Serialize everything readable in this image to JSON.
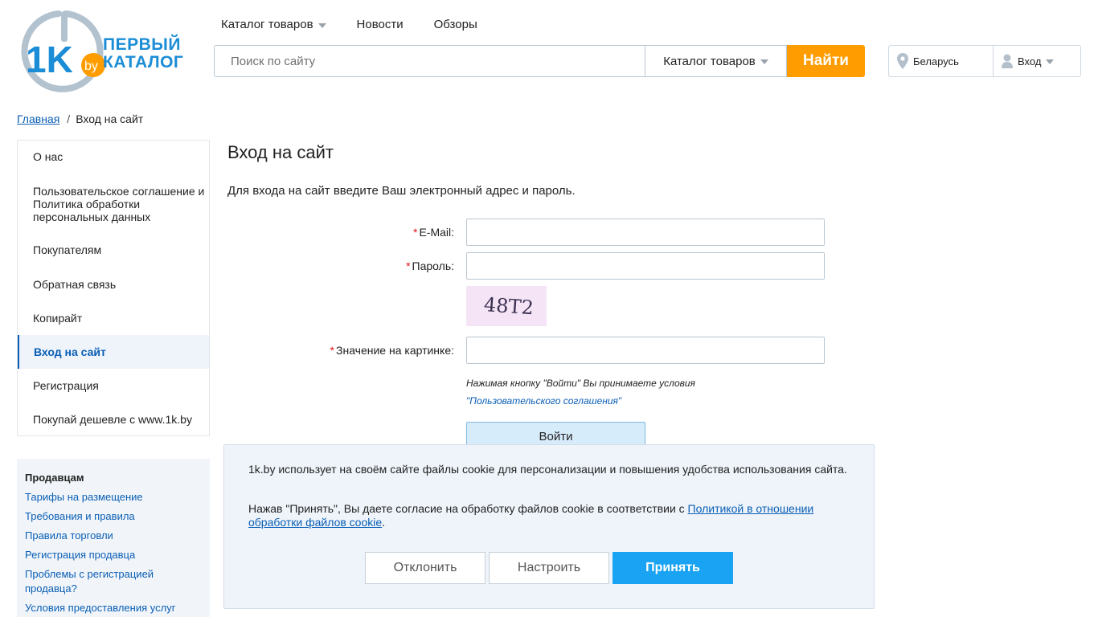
{
  "header": {
    "logo": {
      "main": "1K",
      "badge": "by",
      "line1": "ПЕРВЫЙ",
      "line2": "КАТАЛОГ"
    },
    "nav": [
      "Каталог товаров",
      "Новости",
      "Обзоры"
    ],
    "search": {
      "placeholder": "Поиск по сайту",
      "category": "Каталог товаров",
      "button": "Найти"
    },
    "region": "Беларусь",
    "login": "Вход",
    "colors": {
      "brand": "#1b8dd6",
      "search_button": "#ff9d00"
    }
  },
  "breadcrumb": {
    "home": "Главная",
    "separator": "/",
    "current": "Вход на сайт"
  },
  "sidebar": {
    "items": [
      "О нас",
      "Пользовательское соглашение и Политика обработки персональных данных",
      "Покупателям",
      "Обратная связь",
      "Копирайт",
      "Вход на сайт",
      "Регистрация",
      "Покупай дешевле с www.1k.by"
    ],
    "active_item": "Вход на сайт"
  },
  "sellers": {
    "title": "Продавцам",
    "links": [
      "Тарифы на размещение",
      "Требования и правила",
      "Правила торговли",
      "Регистрация продавца",
      "Проблемы с регистрацией продавца?",
      "Условия предоставления услуг"
    ]
  },
  "main": {
    "title": "Вход на сайт",
    "intro": "Для входа на сайт введите Ваш электронный адрес и пароль.",
    "form": {
      "required_mark": "*",
      "email_label": "E-Mail:",
      "password_label": "Пароль:",
      "captcha_text": "48Т2",
      "captcha_label": "Значение на картинке:",
      "terms_text": "Нажимая кнопку \"Войти\" Вы принимаете условия",
      "terms_link": "\"Пользовательского соглашения\"",
      "submit": "Войти"
    }
  },
  "cookie_banner": {
    "text1": "1k.by использует на своём сайте файлы cookie для персонализации и повышения удобства использования сайта.",
    "text2_prefix": "Нажав \"Принять\", Вы даете согласие на обработку файлов cookie в соответствии с ",
    "text2_link": "Политикой в отношении обработки файлов cookie",
    "text2_suffix": ".",
    "buttons": {
      "decline": "Отклонить",
      "configure": "Настроить",
      "accept": "Принять"
    },
    "colors": {
      "accept": "#1aa3f2"
    }
  }
}
